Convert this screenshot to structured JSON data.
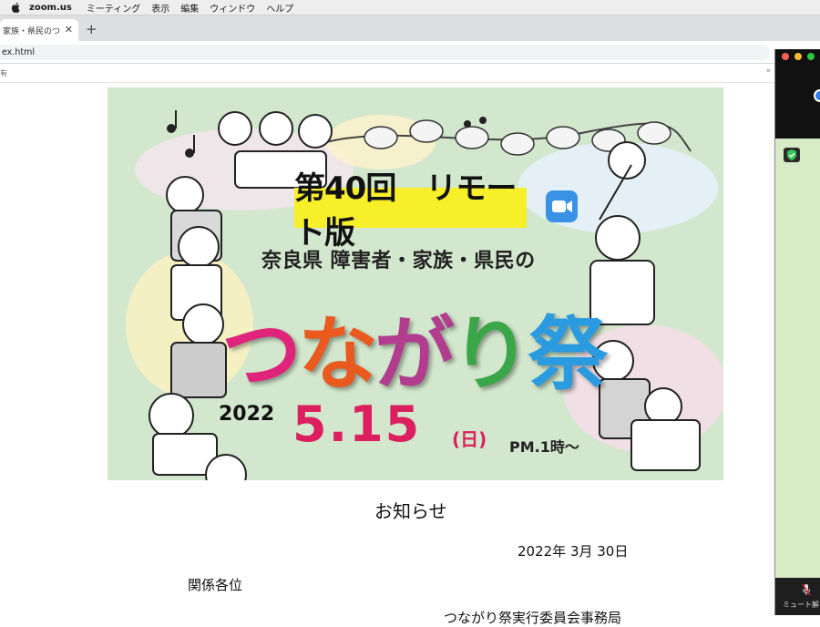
{
  "menubar": {
    "app": "zoom.us",
    "items": [
      "ミーティング",
      "表示",
      "編集",
      "ウィンドウ",
      "ヘルプ"
    ]
  },
  "browser": {
    "tab_title": "家族・県民のつ",
    "tab_close": "✕",
    "new_tab": "+",
    "url": "ex.html",
    "bookmark_fragment": "有",
    "more": "»"
  },
  "banner": {
    "edition": "第40回　リモート版",
    "subtitle": "奈良県 障害者・家族・県民の",
    "main_chars": [
      "つ",
      "な",
      "が",
      "り",
      "祭"
    ],
    "main_colors": [
      "#e0237b",
      "#ea5a1e",
      "#b23d8e",
      "#3aa647",
      "#2a9be0"
    ],
    "year": "2022",
    "date": "5.15",
    "day": "(日)",
    "time": "PM.1時～"
  },
  "notice": {
    "title": "お知らせ",
    "date": "2022年 3月 30日",
    "addressee": "関係各位",
    "sender": "つながり祭実行委員会事務局"
  },
  "zoom_panel": {
    "mute_label": "ミュート解",
    "traffic_colors": [
      "#fe5f57",
      "#febc2e",
      "#28c840"
    ]
  }
}
